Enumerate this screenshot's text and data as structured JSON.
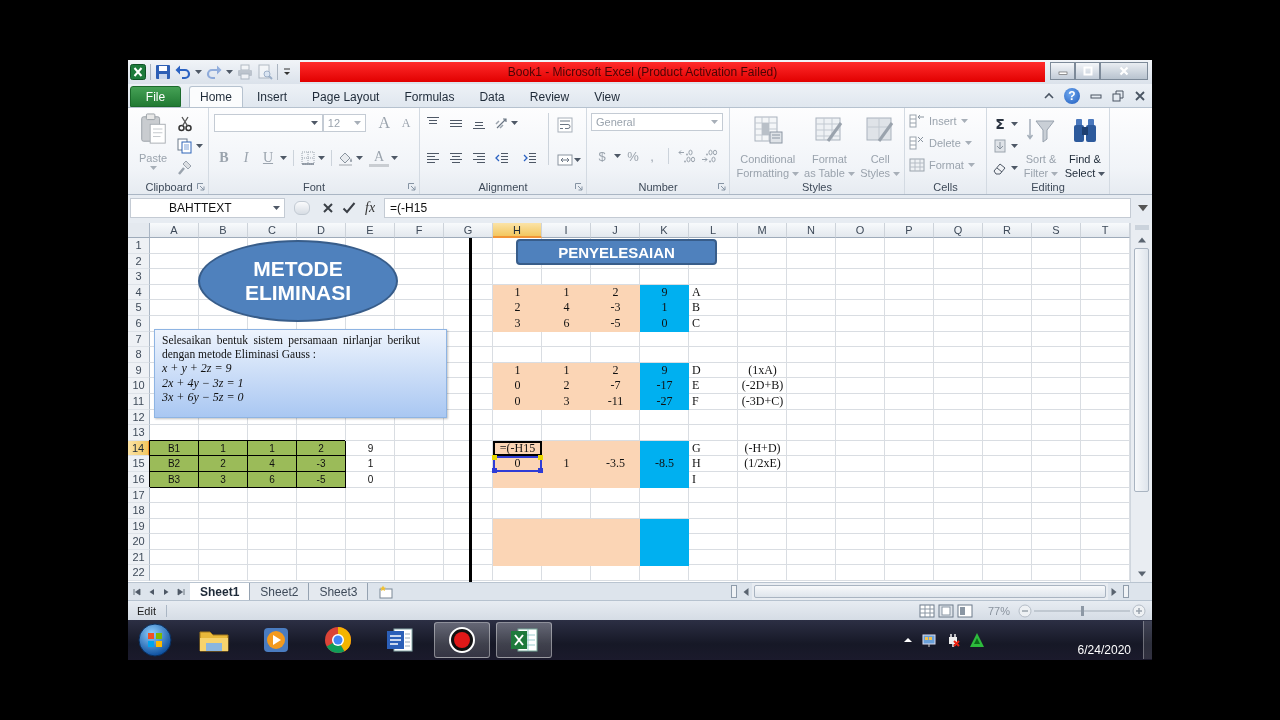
{
  "window": {
    "title": "Book1 - Microsoft Excel (Product Activation Failed)",
    "help": "?"
  },
  "quick_access": [
    {
      "disabled": false
    },
    {
      "disabled": false
    },
    {
      "disabled": true
    },
    {
      "disabled": true
    },
    {
      "disabled": true
    }
  ],
  "ribbon_tabs": [
    {
      "label": "File",
      "kind": "backstage",
      "selected": false
    },
    {
      "label": "Home",
      "kind": "tab",
      "selected": true
    },
    {
      "label": "Insert",
      "kind": "tab",
      "selected": false
    },
    {
      "label": "Page Layout",
      "kind": "tab",
      "selected": false
    },
    {
      "label": "Formulas",
      "kind": "tab",
      "selected": false
    },
    {
      "label": "Data",
      "kind": "tab",
      "selected": false
    },
    {
      "label": "Review",
      "kind": "tab",
      "selected": false
    },
    {
      "label": "View",
      "kind": "tab",
      "selected": false
    }
  ],
  "ribbon": {
    "clipboard": {
      "label": "Clipboard",
      "paste": {
        "label": "Paste",
        "disabled": true
      }
    },
    "font": {
      "label": "Font",
      "size": {
        "value": "12",
        "disabled": true
      },
      "glyphs": [
        {
          "label": "A",
          "kind": "grow",
          "disabled": true
        },
        {
          "label": "A",
          "kind": "shrink",
          "disabled": true
        },
        {
          "label": "B",
          "kind": "bold",
          "disabled": true
        },
        {
          "label": "I",
          "kind": "italic",
          "disabled": true
        },
        {
          "label": "U",
          "kind": "underline",
          "disabled": true
        },
        {
          "label": "A",
          "kind": "color",
          "disabled": true
        }
      ]
    },
    "alignment": {
      "label": "Alignment"
    },
    "number": {
      "label": "Number",
      "format": {
        "value": "General",
        "disabled": true
      },
      "glyphs": [
        {
          "label": "$",
          "disabled": true
        },
        {
          "label": "%",
          "disabled": true
        },
        {
          "label": ",",
          "disabled": true
        }
      ]
    },
    "styles": {
      "label": "Styles",
      "buttons": [
        {
          "lines": [
            "Conditional",
            "Formatting"
          ],
          "disabled": true
        },
        {
          "lines": [
            "Format",
            "as Table"
          ],
          "disabled": true
        },
        {
          "lines": [
            "Cell",
            "Styles"
          ],
          "disabled": true
        }
      ]
    },
    "cells": {
      "label": "Cells",
      "buttons": [
        {
          "label": "Insert",
          "disabled": true
        },
        {
          "label": "Delete",
          "disabled": true
        },
        {
          "label": "Format",
          "disabled": true
        }
      ]
    },
    "editing": {
      "label": "Editing",
      "sum": {
        "label": "Σ",
        "disabled": false
      },
      "buttons": [
        {
          "lines": [
            "Sort &",
            "Filter"
          ],
          "disabled": true
        },
        {
          "lines": [
            "Find &",
            "Select"
          ],
          "disabled": false
        }
      ]
    }
  },
  "formula_bar": {
    "name_box": "BAHTTEXT",
    "function_label": "fx",
    "formula": "=(-H15"
  },
  "sheet": {
    "columns": [
      {
        "label": "A",
        "selected": false
      },
      {
        "label": "B",
        "selected": false
      },
      {
        "label": "C",
        "selected": false
      },
      {
        "label": "D",
        "selected": false
      },
      {
        "label": "E",
        "selected": false
      },
      {
        "label": "F",
        "selected": false
      },
      {
        "label": "G",
        "selected": false
      },
      {
        "label": "H",
        "selected": true
      },
      {
        "label": "I",
        "selected": false
      },
      {
        "label": "J",
        "selected": false
      },
      {
        "label": "K",
        "selected": false
      },
      {
        "label": "L",
        "selected": false
      },
      {
        "label": "M",
        "selected": false
      },
      {
        "label": "N",
        "selected": false
      },
      {
        "label": "O",
        "selected": false
      },
      {
        "label": "P",
        "selected": false
      },
      {
        "label": "Q",
        "selected": false
      },
      {
        "label": "R",
        "selected": false
      },
      {
        "label": "S",
        "selected": false
      },
      {
        "label": "T",
        "selected": false
      }
    ],
    "rows": [
      {
        "label": "1",
        "selected": false,
        "referenced": false
      },
      {
        "label": "2",
        "selected": false,
        "referenced": false
      },
      {
        "label": "3",
        "selected": false,
        "referenced": false
      },
      {
        "label": "4",
        "selected": false,
        "referenced": false,
        "right_cells": [
          {
            "kind": "fill",
            "text": "1",
            "color": "#fbd5b5"
          },
          {
            "kind": "fill",
            "text": "1",
            "color": "#fbd5b5"
          },
          {
            "kind": "fill",
            "text": "2",
            "color": "#fbd5b5"
          },
          {
            "kind": "fill",
            "text": "9",
            "color": "#00b0f0"
          },
          {
            "kind": "text",
            "text": "A"
          }
        ]
      },
      {
        "label": "5",
        "selected": false,
        "referenced": false,
        "right_cells": [
          {
            "kind": "fill",
            "text": "2",
            "color": "#fbd5b5"
          },
          {
            "kind": "fill",
            "text": "4",
            "color": "#fbd5b5"
          },
          {
            "kind": "fill",
            "text": "-3",
            "color": "#fbd5b5"
          },
          {
            "kind": "fill",
            "text": "1",
            "color": "#00b0f0"
          },
          {
            "kind": "text",
            "text": "B"
          }
        ]
      },
      {
        "label": "6",
        "selected": false,
        "referenced": false,
        "right_cells": [
          {
            "kind": "fill",
            "text": "3",
            "color": "#fbd5b5"
          },
          {
            "kind": "fill",
            "text": "6",
            "color": "#fbd5b5"
          },
          {
            "kind": "fill",
            "text": "-5",
            "color": "#fbd5b5"
          },
          {
            "kind": "fill",
            "text": "0",
            "color": "#00b0f0"
          },
          {
            "kind": "text",
            "text": "C"
          }
        ]
      },
      {
        "label": "7",
        "selected": false,
        "referenced": false
      },
      {
        "label": "8",
        "selected": false,
        "referenced": false
      },
      {
        "label": "9",
        "selected": false,
        "referenced": false,
        "right_cells": [
          {
            "kind": "fill",
            "text": "1",
            "color": "#fbd5b5"
          },
          {
            "kind": "fill",
            "text": "1",
            "color": "#fbd5b5"
          },
          {
            "kind": "fill",
            "text": "2",
            "color": "#fbd5b5"
          },
          {
            "kind": "fill",
            "text": "9",
            "color": "#00b0f0"
          },
          {
            "kind": "text",
            "text": "D"
          },
          {
            "kind": "text",
            "text": "(1xA)"
          }
        ]
      },
      {
        "label": "10",
        "selected": false,
        "referenced": false,
        "right_cells": [
          {
            "kind": "fill",
            "text": "0",
            "color": "#fbd5b5"
          },
          {
            "kind": "fill",
            "text": "2",
            "color": "#fbd5b5"
          },
          {
            "kind": "fill",
            "text": "-7",
            "color": "#fbd5b5"
          },
          {
            "kind": "fill",
            "text": "-17",
            "color": "#00b0f0"
          },
          {
            "kind": "text",
            "text": "E"
          },
          {
            "kind": "text",
            "text": "(-2D+B)"
          }
        ]
      },
      {
        "label": "11",
        "selected": false,
        "referenced": false,
        "right_cells": [
          {
            "kind": "fill",
            "text": "0",
            "color": "#fbd5b5"
          },
          {
            "kind": "fill",
            "text": "3",
            "color": "#fbd5b5"
          },
          {
            "kind": "fill",
            "text": "-11",
            "color": "#fbd5b5"
          },
          {
            "kind": "fill",
            "text": "-27",
            "color": "#00b0f0"
          },
          {
            "kind": "text",
            "text": "F"
          },
          {
            "kind": "text",
            "text": "(-3D+C)"
          }
        ]
      },
      {
        "label": "12",
        "selected": false,
        "referenced": false
      },
      {
        "label": "13",
        "selected": false,
        "referenced": false
      },
      {
        "label": "14",
        "selected": true,
        "referenced": false,
        "left_cells": [
          {
            "kind": "bordered",
            "text": "B1",
            "color": "#9bbb59"
          },
          {
            "kind": "bordered",
            "text": "1",
            "color": "#9bbb59"
          },
          {
            "kind": "bordered",
            "text": "1",
            "color": "#9bbb59"
          },
          {
            "kind": "bordered",
            "text": "2",
            "color": "#9bbb59"
          },
          {
            "kind": "text",
            "text": "9"
          }
        ],
        "right_cells": [
          {
            "kind": "fill",
            "text": "=(-H15",
            "color": "#fbd5b5"
          },
          {
            "kind": "fill",
            "color": "#fbd5b5"
          },
          {
            "kind": "fill",
            "color": "#fbd5b5"
          },
          {
            "kind": "fill",
            "color": "#00b0f0"
          },
          {
            "kind": "text",
            "text": "G"
          },
          {
            "kind": "text",
            "text": "(-H+D)"
          }
        ]
      },
      {
        "label": "15",
        "selected": false,
        "referenced": true,
        "left_cells": [
          {
            "kind": "bordered",
            "text": "B2",
            "color": "#9bbb59"
          },
          {
            "kind": "bordered",
            "text": "2",
            "color": "#9bbb59"
          },
          {
            "kind": "bordered",
            "text": "4",
            "color": "#9bbb59"
          },
          {
            "kind": "bordered",
            "text": "-3",
            "color": "#9bbb59"
          },
          {
            "kind": "text",
            "text": "1"
          }
        ],
        "right_cells": [
          {
            "kind": "fill",
            "text": "0",
            "color": "#fbd5b5"
          },
          {
            "kind": "fill",
            "text": "1",
            "color": "#fbd5b5"
          },
          {
            "kind": "fill",
            "text": "-3.5",
            "color": "#fbd5b5"
          },
          {
            "kind": "fill",
            "text": "-8.5",
            "color": "#00b0f0"
          },
          {
            "kind": "text",
            "text": "H"
          },
          {
            "kind": "text",
            "text": "(1/2xE)"
          }
        ]
      },
      {
        "label": "16",
        "selected": false,
        "referenced": false,
        "left_cells": [
          {
            "kind": "bordered",
            "text": "B3",
            "color": "#9bbb59"
          },
          {
            "kind": "bordered",
            "text": "3",
            "color": "#9bbb59"
          },
          {
            "kind": "bordered",
            "text": "6",
            "color": "#9bbb59"
          },
          {
            "kind": "bordered",
            "text": "-5",
            "color": "#9bbb59"
          },
          {
            "kind": "text",
            "text": "0"
          }
        ],
        "right_cells": [
          {
            "kind": "fill",
            "color": "#fbd5b5"
          },
          {
            "kind": "fill",
            "color": "#fbd5b5"
          },
          {
            "kind": "fill",
            "color": "#fbd5b5"
          },
          {
            "kind": "fill",
            "color": "#00b0f0"
          },
          {
            "kind": "text",
            "text": "I"
          }
        ]
      },
      {
        "label": "17",
        "selected": false,
        "referenced": false
      },
      {
        "label": "18",
        "selected": false,
        "referenced": false
      },
      {
        "label": "19",
        "selected": false,
        "referenced": false
      },
      {
        "label": "20",
        "selected": false,
        "referenced": false
      },
      {
        "label": "21",
        "selected": false,
        "referenced": false
      },
      {
        "label": "22",
        "selected": false,
        "referenced": false
      }
    ],
    "blocks": [
      {
        "color": "#fbd5b5"
      },
      {
        "color": "#00b0f0"
      }
    ],
    "shapes": [
      {
        "kind": "ellipse",
        "lines": [
          "METODE",
          "ELIMINASI"
        ]
      },
      {
        "kind": "textbox",
        "paragraph": "Selesaikan bentuk sistem persamaan nirlanjar berikut dengan metode Eliminasi Gauss :",
        "equations": [
          "x + y + 2z = 9",
          "2x + 4y − 3z = 1",
          "3x + 6y − 5z = 0"
        ]
      },
      {
        "kind": "banner",
        "lines": [
          "PENYELESAIAN"
        ]
      }
    ]
  },
  "sheet_tabs": [
    {
      "label": "Sheet1",
      "selected": true
    },
    {
      "label": "Sheet2",
      "selected": false
    },
    {
      "label": "Sheet3",
      "selected": false
    }
  ],
  "status_bar": {
    "mode": "Edit",
    "zoom": "77%",
    "zoom_slider": {
      "level": 0.5
    }
  },
  "taskbar": {
    "apps": [
      {
        "active": false
      },
      {
        "active": false
      },
      {
        "active": false
      },
      {
        "active": false
      },
      {
        "active": true
      },
      {
        "active": true
      }
    ],
    "date": "6/24/2020"
  }
}
